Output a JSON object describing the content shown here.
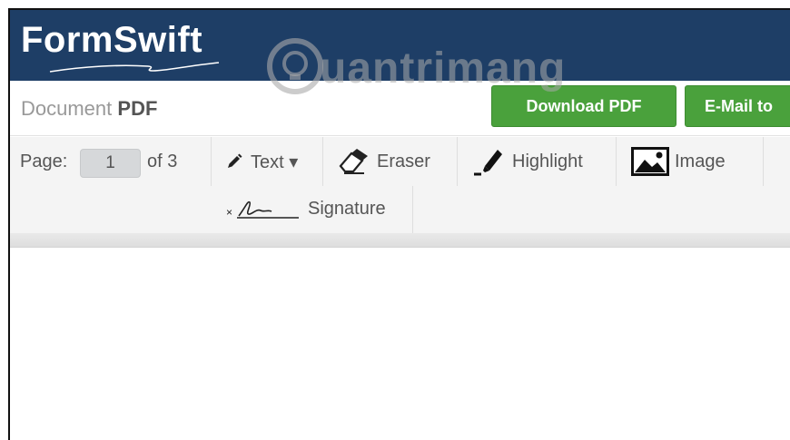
{
  "header": {
    "logo_text": "FormSwift",
    "colors": {
      "header_bg": "#1e3e66",
      "button_green": "#4aa13c"
    }
  },
  "watermark": {
    "text": "uantrimang"
  },
  "titlebar": {
    "title_prefix": "Document",
    "title_bold": "PDF",
    "download_label": "Download PDF",
    "email_label": "E-Mail to"
  },
  "toolbar": {
    "page_label": "Page:",
    "page_value": "1",
    "page_of": "of 3",
    "tools": {
      "text": "Text ▾",
      "eraser": "Eraser",
      "highlight": "Highlight",
      "image": "Image",
      "signature": "Signature"
    },
    "icons": [
      "pencil-icon",
      "eraser-icon",
      "highlighter-icon",
      "image-icon",
      "signature-icon"
    ]
  }
}
